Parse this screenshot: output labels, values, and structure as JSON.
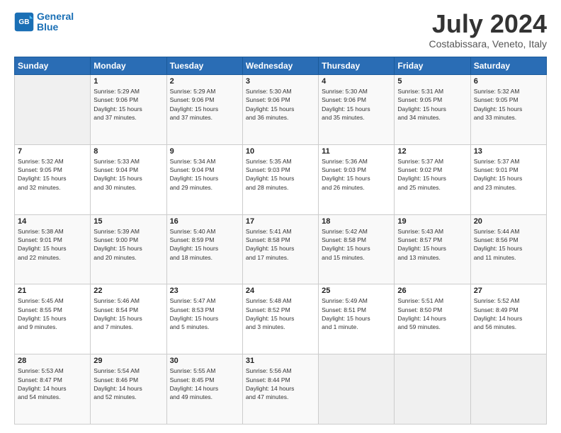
{
  "header": {
    "logo_line1": "General",
    "logo_line2": "Blue",
    "month_title": "July 2024",
    "location": "Costabissara, Veneto, Italy"
  },
  "days_of_week": [
    "Sunday",
    "Monday",
    "Tuesday",
    "Wednesday",
    "Thursday",
    "Friday",
    "Saturday"
  ],
  "weeks": [
    [
      {
        "day": "",
        "info": ""
      },
      {
        "day": "1",
        "info": "Sunrise: 5:29 AM\nSunset: 9:06 PM\nDaylight: 15 hours\nand 37 minutes."
      },
      {
        "day": "2",
        "info": "Sunrise: 5:29 AM\nSunset: 9:06 PM\nDaylight: 15 hours\nand 37 minutes."
      },
      {
        "day": "3",
        "info": "Sunrise: 5:30 AM\nSunset: 9:06 PM\nDaylight: 15 hours\nand 36 minutes."
      },
      {
        "day": "4",
        "info": "Sunrise: 5:30 AM\nSunset: 9:06 PM\nDaylight: 15 hours\nand 35 minutes."
      },
      {
        "day": "5",
        "info": "Sunrise: 5:31 AM\nSunset: 9:05 PM\nDaylight: 15 hours\nand 34 minutes."
      },
      {
        "day": "6",
        "info": "Sunrise: 5:32 AM\nSunset: 9:05 PM\nDaylight: 15 hours\nand 33 minutes."
      }
    ],
    [
      {
        "day": "7",
        "info": "Sunrise: 5:32 AM\nSunset: 9:05 PM\nDaylight: 15 hours\nand 32 minutes."
      },
      {
        "day": "8",
        "info": "Sunrise: 5:33 AM\nSunset: 9:04 PM\nDaylight: 15 hours\nand 30 minutes."
      },
      {
        "day": "9",
        "info": "Sunrise: 5:34 AM\nSunset: 9:04 PM\nDaylight: 15 hours\nand 29 minutes."
      },
      {
        "day": "10",
        "info": "Sunrise: 5:35 AM\nSunset: 9:03 PM\nDaylight: 15 hours\nand 28 minutes."
      },
      {
        "day": "11",
        "info": "Sunrise: 5:36 AM\nSunset: 9:03 PM\nDaylight: 15 hours\nand 26 minutes."
      },
      {
        "day": "12",
        "info": "Sunrise: 5:37 AM\nSunset: 9:02 PM\nDaylight: 15 hours\nand 25 minutes."
      },
      {
        "day": "13",
        "info": "Sunrise: 5:37 AM\nSunset: 9:01 PM\nDaylight: 15 hours\nand 23 minutes."
      }
    ],
    [
      {
        "day": "14",
        "info": "Sunrise: 5:38 AM\nSunset: 9:01 PM\nDaylight: 15 hours\nand 22 minutes."
      },
      {
        "day": "15",
        "info": "Sunrise: 5:39 AM\nSunset: 9:00 PM\nDaylight: 15 hours\nand 20 minutes."
      },
      {
        "day": "16",
        "info": "Sunrise: 5:40 AM\nSunset: 8:59 PM\nDaylight: 15 hours\nand 18 minutes."
      },
      {
        "day": "17",
        "info": "Sunrise: 5:41 AM\nSunset: 8:58 PM\nDaylight: 15 hours\nand 17 minutes."
      },
      {
        "day": "18",
        "info": "Sunrise: 5:42 AM\nSunset: 8:58 PM\nDaylight: 15 hours\nand 15 minutes."
      },
      {
        "day": "19",
        "info": "Sunrise: 5:43 AM\nSunset: 8:57 PM\nDaylight: 15 hours\nand 13 minutes."
      },
      {
        "day": "20",
        "info": "Sunrise: 5:44 AM\nSunset: 8:56 PM\nDaylight: 15 hours\nand 11 minutes."
      }
    ],
    [
      {
        "day": "21",
        "info": "Sunrise: 5:45 AM\nSunset: 8:55 PM\nDaylight: 15 hours\nand 9 minutes."
      },
      {
        "day": "22",
        "info": "Sunrise: 5:46 AM\nSunset: 8:54 PM\nDaylight: 15 hours\nand 7 minutes."
      },
      {
        "day": "23",
        "info": "Sunrise: 5:47 AM\nSunset: 8:53 PM\nDaylight: 15 hours\nand 5 minutes."
      },
      {
        "day": "24",
        "info": "Sunrise: 5:48 AM\nSunset: 8:52 PM\nDaylight: 15 hours\nand 3 minutes."
      },
      {
        "day": "25",
        "info": "Sunrise: 5:49 AM\nSunset: 8:51 PM\nDaylight: 15 hours\nand 1 minute."
      },
      {
        "day": "26",
        "info": "Sunrise: 5:51 AM\nSunset: 8:50 PM\nDaylight: 14 hours\nand 59 minutes."
      },
      {
        "day": "27",
        "info": "Sunrise: 5:52 AM\nSunset: 8:49 PM\nDaylight: 14 hours\nand 56 minutes."
      }
    ],
    [
      {
        "day": "28",
        "info": "Sunrise: 5:53 AM\nSunset: 8:47 PM\nDaylight: 14 hours\nand 54 minutes."
      },
      {
        "day": "29",
        "info": "Sunrise: 5:54 AM\nSunset: 8:46 PM\nDaylight: 14 hours\nand 52 minutes."
      },
      {
        "day": "30",
        "info": "Sunrise: 5:55 AM\nSunset: 8:45 PM\nDaylight: 14 hours\nand 49 minutes."
      },
      {
        "day": "31",
        "info": "Sunrise: 5:56 AM\nSunset: 8:44 PM\nDaylight: 14 hours\nand 47 minutes."
      },
      {
        "day": "",
        "info": ""
      },
      {
        "day": "",
        "info": ""
      },
      {
        "day": "",
        "info": ""
      }
    ]
  ]
}
